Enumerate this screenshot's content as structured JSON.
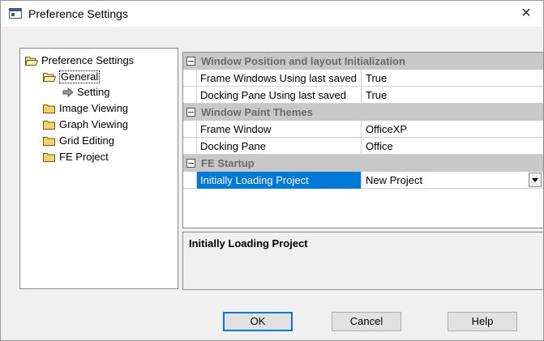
{
  "window": {
    "title": "Preference Settings",
    "close_symbol": "×"
  },
  "tree": {
    "root": "Preference Settings",
    "items": [
      {
        "label": "General",
        "selected": true
      },
      {
        "label": "Setting"
      },
      {
        "label": "Image Viewing"
      },
      {
        "label": "Graph Viewing"
      },
      {
        "label": "Grid Editing"
      },
      {
        "label": "FE Project"
      }
    ]
  },
  "grid": {
    "categories": [
      {
        "label": "Window Position and layout Initialization",
        "props": [
          {
            "name": "Frame Windows Using last saved",
            "value": "True"
          },
          {
            "name": "Docking Pane Using last saved",
            "value": "True"
          }
        ]
      },
      {
        "label": "Window Paint Themes",
        "props": [
          {
            "name": "Frame Window",
            "value": "OfficeXP"
          },
          {
            "name": "Docking Pane",
            "value": "Office"
          }
        ]
      },
      {
        "label": "FE Startup",
        "props": [
          {
            "name": "Initially Loading Project",
            "value": "New Project"
          }
        ]
      }
    ]
  },
  "description": {
    "title": "Initially Loading Project"
  },
  "buttons": {
    "ok": "OK",
    "cancel": "Cancel",
    "help": "Help"
  }
}
